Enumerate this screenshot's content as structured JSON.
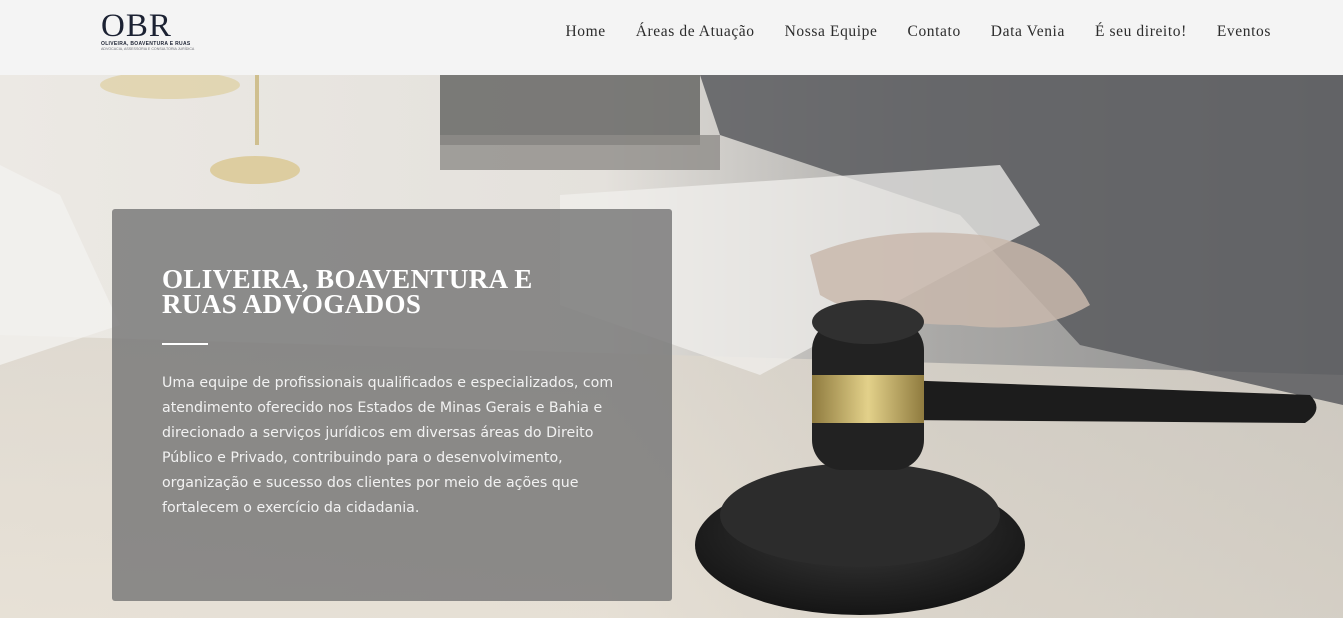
{
  "header": {
    "logo": {
      "mark": "OBR",
      "name": "OLIVEIRA, BOAVENTURA E RUAS",
      "tagline": "ADVOCACIA, ASSESSORIA E CONSULTORIA JURÍDICA"
    },
    "nav": [
      {
        "label": "Home"
      },
      {
        "label": "Áreas de Atuação"
      },
      {
        "label": "Nossa Equipe"
      },
      {
        "label": "Contato"
      },
      {
        "label": "Data Venia"
      },
      {
        "label": "É seu direito!"
      },
      {
        "label": "Eventos"
      }
    ]
  },
  "hero": {
    "title": "OLIVEIRA, BOAVENTURA E RUAS ADVOGADOS",
    "description": "Uma equipe de profissionais qualificados e especializados, com atendimento oferecido nos Estados de Minas Gerais e Bahia e direcionado a serviços jurídicos em diversas áreas do Direito Público e Privado, contribuindo para o desenvolvimento, organização e sucesso dos clientes por meio de ações que fortalecem o exercício da cidadania."
  },
  "colors": {
    "header_bg": "#f4f4f4",
    "brand_navy": "#1c2233",
    "card_bg": "#767676",
    "text_white": "#ffffff"
  }
}
